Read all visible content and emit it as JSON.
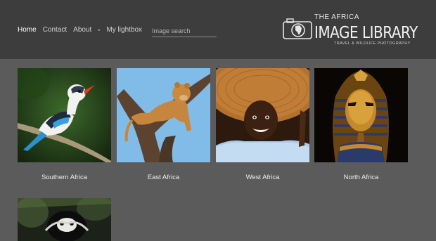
{
  "nav": {
    "items": [
      {
        "label": "Home"
      },
      {
        "label": "Contact"
      },
      {
        "label": "About"
      },
      {
        "label": "My lightbox"
      }
    ],
    "separator": "•"
  },
  "search": {
    "placeholder": "Image search",
    "value": ""
  },
  "logo": {
    "top": "THE AFRICA",
    "main": "IMAGE LIBRARY",
    "sub": "TRAVEL & WILDLIFE PHOTOGRAPHY"
  },
  "gallery": {
    "items": [
      {
        "caption": "Southern Africa",
        "image": "kingfisher-bird-on-branch"
      },
      {
        "caption": "East Africa",
        "image": "lion-cub-in-tree"
      },
      {
        "caption": "West Africa",
        "image": "smiling-girl-straw-hat"
      },
      {
        "caption": "North Africa",
        "image": "golden-pharaoh-mask"
      },
      {
        "caption": "",
        "image": "lemur-in-trees"
      }
    ]
  }
}
